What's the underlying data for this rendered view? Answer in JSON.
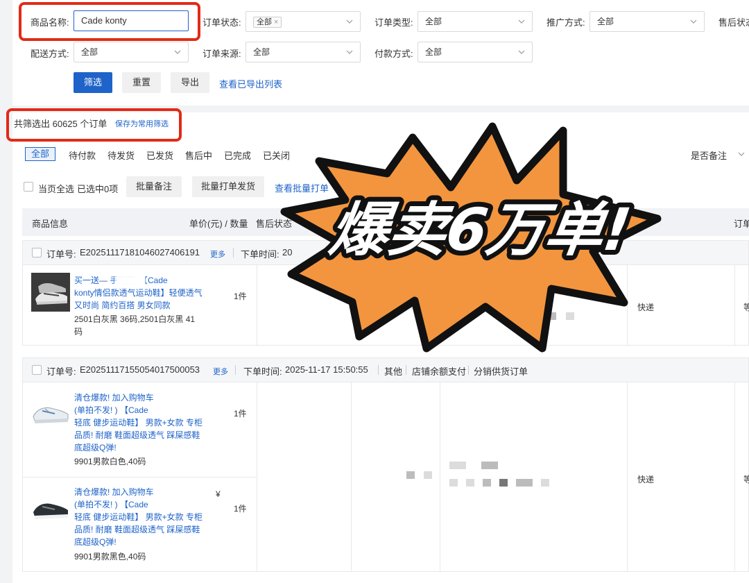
{
  "filters": {
    "product_name_label": "商品名称:",
    "product_name_value": "Cade konty",
    "order_status_label": "订单状态:",
    "order_status_tag": "全部",
    "order_type_label": "订单类型:",
    "order_type_value": "全部",
    "promo_label": "推广方式:",
    "promo_value": "全部",
    "after_sale_label": "售后状态",
    "delivery_label": "配送方式:",
    "delivery_value": "全部",
    "source_label": "订单来源:",
    "source_value": "全部",
    "payment_label": "付款方式:",
    "payment_value": "全部",
    "filter_btn": "筛选",
    "reset_btn": "重置",
    "export_btn": "导出",
    "view_exported_link": "查看已导出列表"
  },
  "summary": {
    "count_text": "共筛选出 60625 个订单",
    "save_common_link": "保存为常用筛选"
  },
  "status_tabs": [
    "全部",
    "待付款",
    "待发货",
    "已发货",
    "售后中",
    "已完成",
    "已关闭"
  ],
  "remark_filter": "是否备注",
  "bulk": {
    "select_page_label": "当页全选",
    "selected_count": "已选中0项",
    "bulk_remark_btn": "批量备注",
    "bulk_print_btn": "批量打单发货",
    "view_bulk_link": "查看批量打单"
  },
  "table_headers": {
    "product_info": "商品信息",
    "price_qty": "单价(元) / 数量",
    "after_sale": "售后状态",
    "receipt": "订单"
  },
  "orders": [
    {
      "order_no_label": "订单号:",
      "order_no": "E20251117181046027406191",
      "more": "更多",
      "time_label": "下单时间: ",
      "time_value": "20",
      "items": [
        {
          "title_lines": [
            "买一送—        手两双! 【Cade",
            "konty情侣款透气运动鞋】轻便透气",
            "又时尚 简约百搭 男女同款"
          ],
          "sku_lines": [
            "2501白灰黑 36码,2501白灰黑 41",
            "码"
          ],
          "qty": "1件"
        }
      ],
      "shipping": "快递",
      "last_col": "等"
    },
    {
      "order_no_label": "订单号:",
      "order_no": "E20251117155054017500053",
      "more": "更多",
      "time_label": "下单时间: ",
      "time_value": "2025-11-17 15:50:55",
      "channel": "其他",
      "pay_method": "店铺余额支付",
      "order_kind": "分销供货订单",
      "items": [
        {
          "title_lines": [
            "清仓爆款! 加入购物车",
            "(单拍不发! ) 【Cade",
            "轻底 健步运动鞋】 男款+女款 专柜",
            "品质! 耐磨 鞋面超级透气 踩屎感鞋",
            "底超级Q弹!"
          ],
          "sku_lines": [
            "9901男款白色,40码"
          ],
          "qty": "1件"
        },
        {
          "title_lines": [
            "清仓爆款! 加入购物车",
            "(单拍不发! ) 【Cade",
            "轻底 健步运动鞋】 男款+女款 专柜",
            "品质! 耐磨 鞋面超级透气 踩屎感鞋",
            "底超级Q弹!"
          ],
          "sku_lines": [
            "9901男款黑色,40码"
          ],
          "qty": "1件",
          "price_mark": "¥"
        }
      ],
      "shipping": "快递",
      "last_col": "等"
    }
  ],
  "overlay": {
    "headline": "爆卖6万单!"
  },
  "colors": {
    "brand_blue": "#1e63c9",
    "highlight_red": "#e22a16",
    "burst_orange": "#f3953e"
  }
}
